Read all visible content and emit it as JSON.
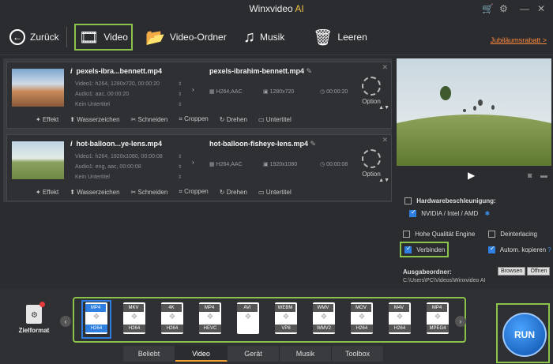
{
  "app": {
    "title": "Winxvideo",
    "title_suffix": "AI"
  },
  "titlebar_icons": [
    "cart-icon",
    "gear-icon",
    "minimize-icon",
    "close-icon"
  ],
  "toolbar": {
    "back": "Zurück",
    "video": "Video",
    "video_folder": "Video-Ordner",
    "music": "Musik",
    "clear": "Leeren",
    "promo": "Jubiläumsrabatt >"
  },
  "files": [
    {
      "name": "pexels-ibra...bennett.mp4",
      "video_info": "Video1: h264, 1280x720, 00:00:20",
      "audio_info": "Audio1: aac, 00:00:20",
      "subtitle": "Kein Untertitel",
      "out_name": "pexels-ibrahim-bennett.mp4",
      "out_codec": "H264,AAC",
      "out_res": "1280x720",
      "out_time": "00:00:20",
      "option": "Option"
    },
    {
      "name": "hot-balloon...ye-lens.mp4",
      "video_info": "Video1: h264, 1920x1080, 00:00:08",
      "audio_info": "Audio1: eng, aac, 00:00:08",
      "subtitle": "Kein Untertitel",
      "out_name": "hot-balloon-fisheye-lens.mp4",
      "out_codec": "H264,AAC",
      "out_res": "1920x1080",
      "out_time": "00:00:08",
      "option": "Option"
    }
  ],
  "edit_actions": [
    "Effekt",
    "Wasserzeichen",
    "Schneiden",
    "Croppen",
    "Drehen",
    "Untertitel"
  ],
  "settings": {
    "hw_accel": "Hardwarebeschleunigung:",
    "gpu": "NVIDIA / Intel / AMD",
    "hq_engine": "Hohe Qualität Engine",
    "deinterlacing": "Deinterlacing",
    "merge": "Verbinden",
    "auto_copy": "Autom. kopieren",
    "output_folder_label": "Ausgabeordner:",
    "output_path": "C:\\Users\\PC\\Videos\\Winxvideo AI",
    "browse": "Browsen",
    "open": "Öffnen"
  },
  "target": {
    "label": "Zielformat"
  },
  "formats": [
    {
      "top": "MP4",
      "bottom": "H264",
      "selected": true
    },
    {
      "top": "MKV",
      "bottom": "H264"
    },
    {
      "top": "4K",
      "bottom": "H264"
    },
    {
      "top": "MP4",
      "bottom": "HEVC"
    },
    {
      "top": "AVI",
      "bottom": ""
    },
    {
      "top": "WEBM",
      "bottom": "VP8"
    },
    {
      "top": "WMV",
      "bottom": "WMV2"
    },
    {
      "top": "MOV",
      "bottom": "H264"
    },
    {
      "top": "M4V",
      "bottom": "H264"
    },
    {
      "top": "MP4",
      "bottom": "MPEG4"
    }
  ],
  "tabs": [
    "Beliebt",
    "Video",
    "Gerät",
    "Musik",
    "Toolbox"
  ],
  "active_tab": "Video",
  "run": "RUN"
}
